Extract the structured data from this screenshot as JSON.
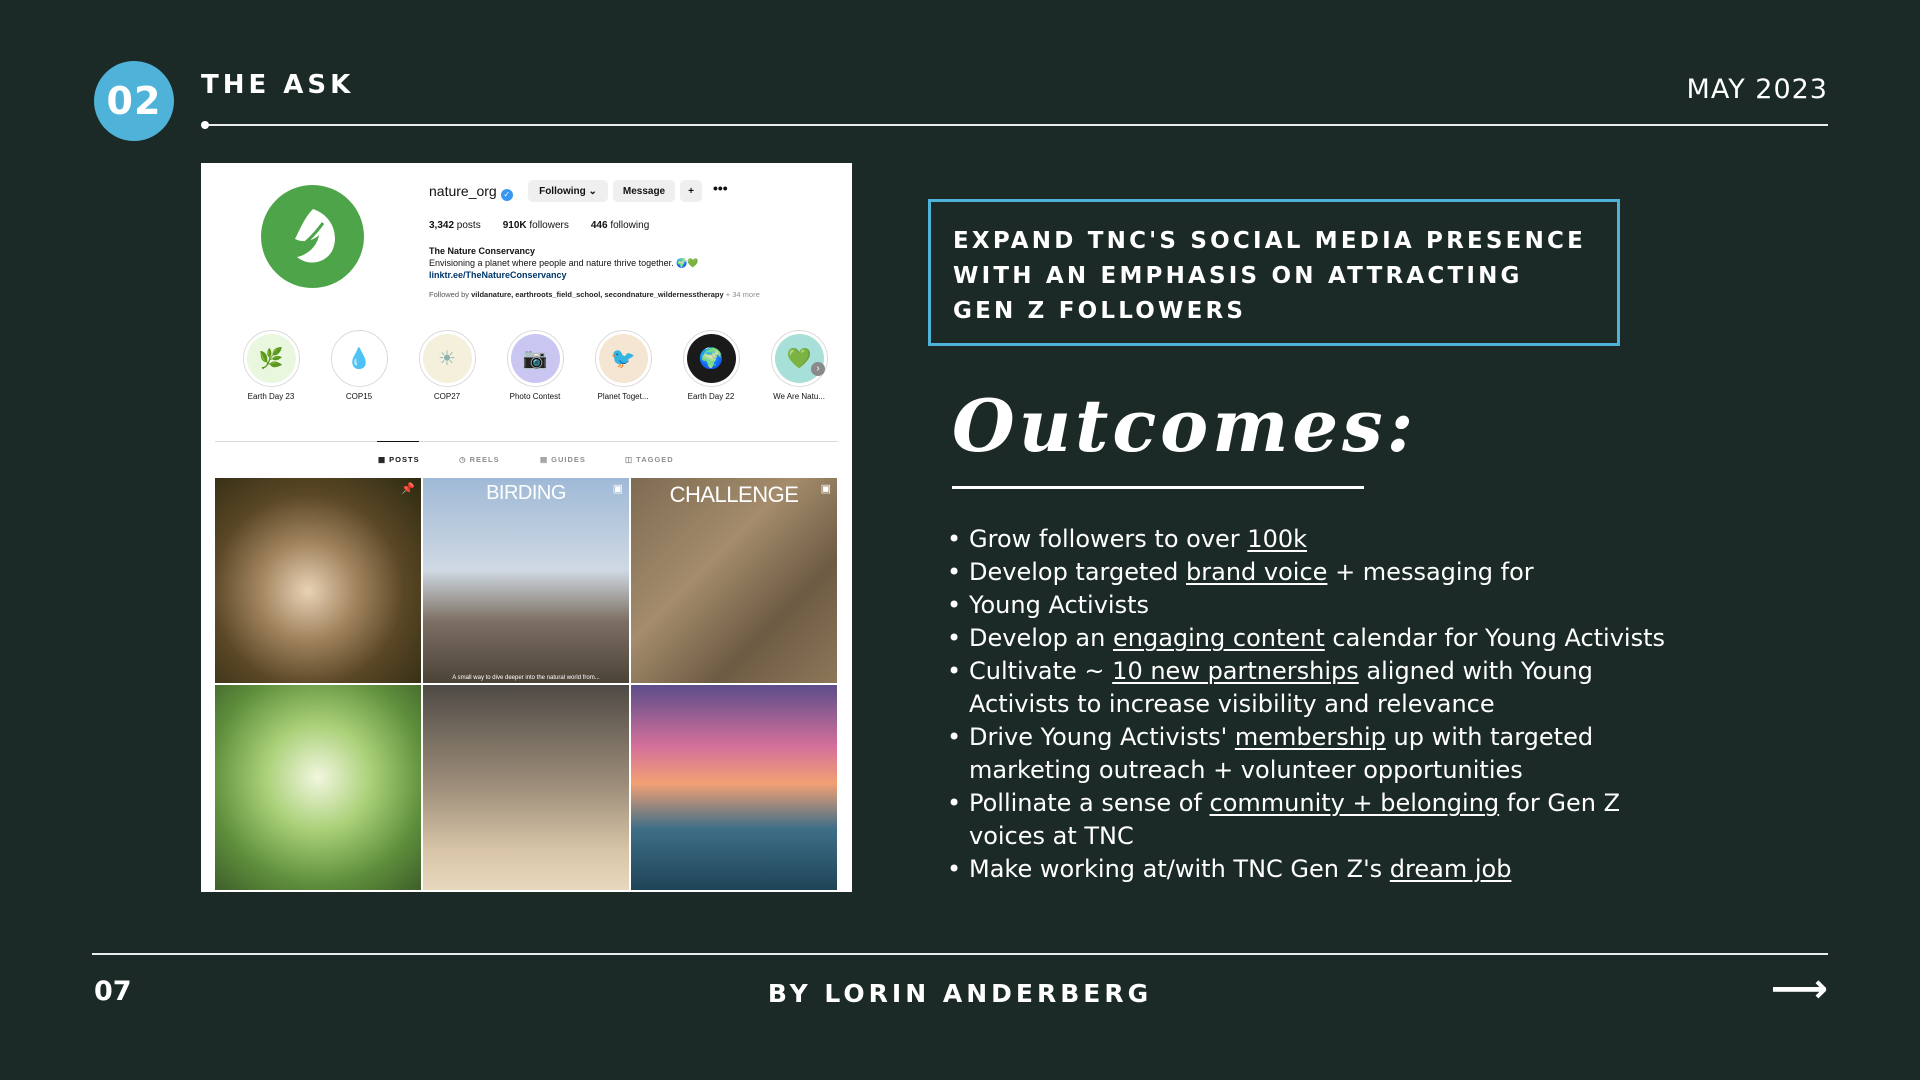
{
  "header": {
    "badge": "02",
    "section_title": "THE ASK",
    "date": "MAY 2023"
  },
  "instagram": {
    "username": "nature_org",
    "buttons": {
      "following": "Following ⌄",
      "message": "Message",
      "add_user": "+"
    },
    "stats": {
      "posts": "3,342",
      "posts_label": " posts",
      "followers": "910K",
      "followers_label": " followers",
      "following": "446",
      "following_label": " following"
    },
    "bio": {
      "name": "The Nature Conservancy",
      "tagline": "Envisioning a planet where people and nature thrive together. 🌍💚",
      "link": "linktr.ee/TheNatureConservancy"
    },
    "followed_by": {
      "prefix": "Followed by ",
      "names": "vildanature, earthroots_field_school, secondnature_wildernesstherapy",
      "more": " + 34 more"
    },
    "highlights": [
      {
        "label": "Earth Day 23",
        "icon": "🌿",
        "color": "#eaf7df"
      },
      {
        "label": "COP15",
        "icon": "💧",
        "color": "#ffffff"
      },
      {
        "label": "COP27",
        "icon": "☀",
        "color": "#f4f0dc"
      },
      {
        "label": "Photo Contest",
        "icon": "📷",
        "color": "#c9c6f2"
      },
      {
        "label": "Planet Toget...",
        "icon": "🐦",
        "color": "#f5e6d3"
      },
      {
        "label": "Earth Day 22",
        "icon": "🌍",
        "color": "#1a1a1a"
      },
      {
        "label": "We Are Natu...",
        "icon": "💚",
        "color": "#a7e0d8"
      }
    ],
    "tabs": [
      "▦ POSTS",
      "◷ REELS",
      "▤ GUIDES",
      "◫ TAGGED"
    ],
    "posts": [
      {
        "overlay": "",
        "icon": "📌"
      },
      {
        "overlay": "BIRDING",
        "icon": "▣"
      },
      {
        "overlay": "CHALLENGE",
        "icon": "▣"
      },
      {
        "overlay": "",
        "icon": ""
      },
      {
        "overlay": "",
        "icon": ""
      },
      {
        "overlay": "",
        "icon": ""
      }
    ],
    "post2_caption": "A small way to dive deeper into the natural world from..."
  },
  "ask": "EXPAND TNC'S SOCIAL MEDIA PRESENCE WITH AN EMPHASIS ON ATTRACTING GEN Z FOLLOWERS",
  "outcomes": {
    "title": "Outcomes:",
    "items": [
      {
        "pre": "Grow followers to over ",
        "em": "100k",
        "post": ""
      },
      {
        "pre": "Develop targeted ",
        "em": "brand voice",
        "post": " + messaging for"
      },
      {
        "pre": "Young Activists",
        "em": "",
        "post": ""
      },
      {
        "pre": "Develop an ",
        "em": "engaging content",
        "post": " calendar for Young Activists"
      },
      {
        "pre": "Cultivate ~ ",
        "em": "10 new partnerships",
        "post": " aligned with Young Activists to increase visibility and relevance"
      },
      {
        "pre": "Drive Young Activists' ",
        "em": "membership",
        "post": " up with targeted marketing outreach + volunteer opportunities"
      },
      {
        "pre": "Pollinate a sense of ",
        "em": "community + belonging",
        "post": " for Gen Z voices at TNC"
      },
      {
        "pre": "Make working at/with TNC Gen Z's ",
        "em": "dream job",
        "post": ""
      }
    ]
  },
  "footer": {
    "page": "07",
    "author": "BY LORIN ANDERBERG",
    "next": "⟶"
  },
  "colors": {
    "background": "#1b2a26",
    "accent": "#4fb3d9",
    "text": "#ffffff"
  }
}
